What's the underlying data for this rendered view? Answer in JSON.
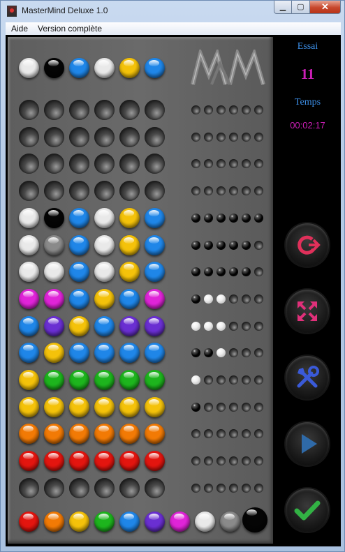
{
  "window": {
    "title": "MasterMind Deluxe 1.0",
    "minimize": "▁",
    "maximize": "▢",
    "close": "✕"
  },
  "menu": [
    "Aide",
    "Version complète"
  ],
  "colors": {
    "white": "#e9e9e9",
    "black": "#050505",
    "blue": "#1f86e8",
    "yellow": "#f4c20a",
    "magenta": "#e024d8",
    "purple": "#6a2fd2",
    "green": "#1db51d",
    "orange": "#f27a05",
    "red": "#e3150f",
    "gray": "#8a8a8a"
  },
  "secret": [
    "white",
    "black",
    "blue",
    "white",
    "yellow",
    "blue"
  ],
  "rows": [
    {
      "pegs": [
        null,
        null,
        null,
        null,
        null,
        null
      ],
      "keys": [
        null,
        null,
        null,
        null,
        null,
        null
      ]
    },
    {
      "pegs": [
        null,
        null,
        null,
        null,
        null,
        null
      ],
      "keys": [
        null,
        null,
        null,
        null,
        null,
        null
      ]
    },
    {
      "pegs": [
        null,
        null,
        null,
        null,
        null,
        null
      ],
      "keys": [
        null,
        null,
        null,
        null,
        null,
        null
      ]
    },
    {
      "pegs": [
        null,
        null,
        null,
        null,
        null,
        null
      ],
      "keys": [
        null,
        null,
        null,
        null,
        null,
        null
      ]
    },
    {
      "pegs": [
        "white",
        "black",
        "blue",
        "white",
        "yellow",
        "blue"
      ],
      "keys": [
        "black",
        "black",
        "black",
        "black",
        "black",
        "black"
      ]
    },
    {
      "pegs": [
        "white",
        "gray",
        "blue",
        "white",
        "yellow",
        "blue"
      ],
      "keys": [
        "black",
        "black",
        "black",
        "black",
        "black",
        null
      ]
    },
    {
      "pegs": [
        "white",
        "white",
        "blue",
        "white",
        "yellow",
        "blue"
      ],
      "keys": [
        "black",
        "black",
        "black",
        "black",
        "black",
        null
      ]
    },
    {
      "pegs": [
        "magenta",
        "magenta",
        "blue",
        "yellow",
        "blue",
        "magenta"
      ],
      "keys": [
        "black",
        "white",
        "white",
        null,
        null,
        null
      ]
    },
    {
      "pegs": [
        "blue",
        "purple",
        "yellow",
        "blue",
        "purple",
        "purple"
      ],
      "keys": [
        "white",
        "white",
        "white",
        null,
        null,
        null
      ]
    },
    {
      "pegs": [
        "blue",
        "yellow",
        "blue",
        "blue",
        "blue",
        "blue"
      ],
      "keys": [
        "black",
        "black",
        "white",
        null,
        null,
        null
      ]
    },
    {
      "pegs": [
        "yellow",
        "green",
        "green",
        "green",
        "green",
        "green"
      ],
      "keys": [
        "white",
        null,
        null,
        null,
        null,
        null
      ]
    },
    {
      "pegs": [
        "yellow",
        "yellow",
        "yellow",
        "yellow",
        "yellow",
        "yellow"
      ],
      "keys": [
        "black",
        null,
        null,
        null,
        null,
        null
      ]
    },
    {
      "pegs": [
        "orange",
        "orange",
        "orange",
        "orange",
        "orange",
        "orange"
      ],
      "keys": [
        null,
        null,
        null,
        null,
        null,
        null
      ]
    },
    {
      "pegs": [
        "red",
        "red",
        "red",
        "red",
        "red",
        "red"
      ],
      "keys": [
        null,
        null,
        null,
        null,
        null,
        null
      ]
    },
    {
      "pegs": [
        null,
        null,
        null,
        null,
        null,
        null
      ],
      "keys": [
        null,
        null,
        null,
        null,
        null,
        null
      ]
    }
  ],
  "palette": [
    "red",
    "orange",
    "yellow",
    "green",
    "blue",
    "purple",
    "magenta",
    "white",
    "gray",
    "black"
  ],
  "side": {
    "essai_label": "Essai",
    "essai_value": "11",
    "temps_label": "Temps",
    "temps_value": "00:02:17"
  },
  "side_colors": {
    "label": "#3c8fe8",
    "value": "#cc1eb6"
  },
  "buttons": [
    "restart-icon",
    "expand-icon",
    "settings-tools-icon",
    "play-icon",
    "check-icon"
  ]
}
